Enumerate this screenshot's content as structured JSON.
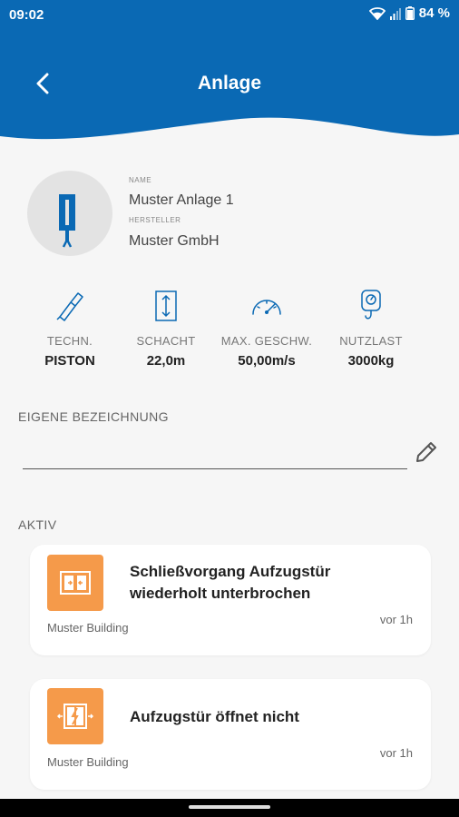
{
  "status_bar": {
    "time": "09:02",
    "battery": "84 %"
  },
  "header": {
    "title": "Anlage"
  },
  "colors": {
    "brand_blue": "#0a69b4",
    "accent_orange": "#f59a4a"
  },
  "equipment": {
    "name_label": "NAME",
    "name": "Muster Anlage 1",
    "manufacturer_label": "HERSTELLER",
    "manufacturer": "Muster GmbH"
  },
  "specs": [
    {
      "icon": "technology-icon",
      "label": "TECHN.",
      "value": "PISTON"
    },
    {
      "icon": "shaft-icon",
      "label": "SCHACHT",
      "value": "22,0m"
    },
    {
      "icon": "speedometer-icon",
      "label": "MAX. GESCHW.",
      "value": "50,00m/s"
    },
    {
      "icon": "weight-icon",
      "label": "NUTZLAST",
      "value": "3000kg"
    }
  ],
  "custom_name": {
    "label": "EIGENE BEZEICHNUNG",
    "value": "",
    "placeholder": ""
  },
  "active_section": {
    "label": "AKTIV",
    "alerts": [
      {
        "icon": "door-closing-icon",
        "title": "Schließvorgang Aufzugstür wiederholt unterbrochen",
        "location": "Muster Building",
        "time": "vor 1h"
      },
      {
        "icon": "door-open-fault-icon",
        "title": "Aufzugstür öffnet nicht",
        "location": "Muster Building",
        "time": "vor 1h"
      }
    ]
  }
}
